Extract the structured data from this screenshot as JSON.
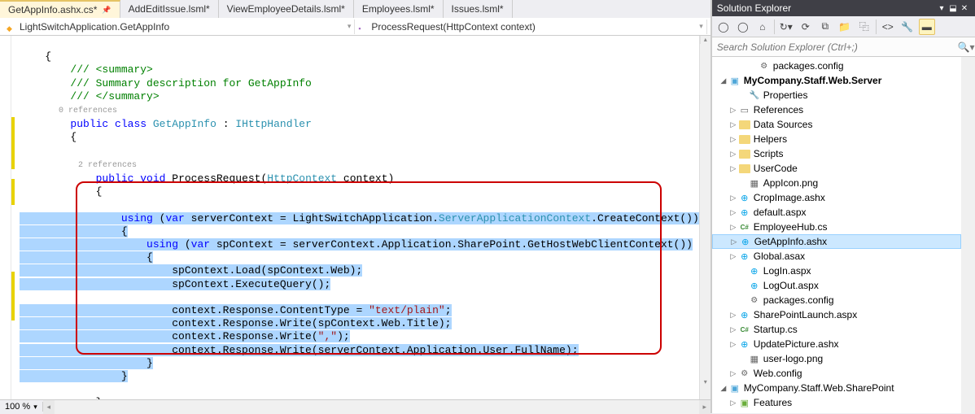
{
  "tabs": [
    {
      "label": "GetAppInfo.ashx.cs*",
      "active": true,
      "pinned": true
    },
    {
      "label": "AddEditIssue.lsml*",
      "active": false
    },
    {
      "label": "ViewEmployeeDetails.lsml*",
      "active": false
    },
    {
      "label": "Employees.lsml*",
      "active": false
    },
    {
      "label": "Issues.lsml*",
      "active": false
    }
  ],
  "crumb_left": "LightSwitchApplication.GetAppInfo",
  "crumb_right": "ProcessRequest(HttpContext context)",
  "zoom": "100 %",
  "code": {
    "l1": "    {",
    "l2": "        /// <summary>",
    "l3": "        /// Summary description for GetAppInfo",
    "l4": "        /// </summary>",
    "l5_ref": "        0 references",
    "l5_a": "        ",
    "l5_b": "public",
    " l5_c": " ",
    "l5_d": "class",
    "l5_e": " ",
    "l5_f": "GetAppInfo",
    "l5_g": " : ",
    "l5_h": "IHttpHandler",
    "l6": "        {",
    "l7": "",
    "l8_ref": "            2 references",
    "l8_a": "            ",
    "l8_b": "public",
    "l8_c": " ",
    "l8_d": "void",
    "l8_e": " ProcessRequest(",
    "l8_f": "HttpContext",
    "l8_g": " context)",
    "l9": "            {",
    "l10": "",
    "l11_a": "                ",
    "l11_b": "using",
    "l11_c": " (",
    "l11_d": "var",
    "l11_e": " serverContext = LightSwitchApplication.",
    "l11_f": "ServerApplicationContext",
    "l11_g": ".CreateContext())",
    "l12": "                {",
    "l13_a": "                    ",
    "l13_b": "using",
    "l13_c": " (",
    "l13_d": "var",
    "l13_e": " spContext = serverContext.Application.SharePoint.GetHostWebClientContext())",
    "l14": "                    {",
    "l15": "                        spContext.Load(spContext.Web);",
    "l16": "                        spContext.ExecuteQuery();",
    "l17": "",
    "l18_a": "                        context.Response.ContentType = ",
    "l18_b": "\"text/plain\"",
    "l18_c": ";",
    "l19": "                        context.Response.Write(spContext.Web.Title);",
    "l20_a": "                        context.Response.Write(",
    "l20_b": "\",\"",
    "l20_c": ");",
    "l21": "                        context.Response.Write(serverContext.Application.User.FullName);",
    "l22": "                    }",
    "l23": "                }",
    "l24": "",
    "l25": "            }"
  },
  "panel_title": "Solution Explorer",
  "search_placeholder": "Search Solution Explorer (Ctrl+;)",
  "tree": {
    "n0": "packages.config",
    "n1": "MyCompany.Staff.Web.Server",
    "n2": "Properties",
    "n3": "References",
    "n4": "Data Sources",
    "n5": "Helpers",
    "n6": "Scripts",
    "n7": "UserCode",
    "n8": "AppIcon.png",
    "n9": "CropImage.ashx",
    "n10": "default.aspx",
    "n11": "EmployeeHub.cs",
    "n12": "GetAppInfo.ashx",
    "n13": "Global.asax",
    "n14": "LogIn.aspx",
    "n15": "LogOut.aspx",
    "n16": "packages.config",
    "n17": "SharePointLaunch.aspx",
    "n18": "Startup.cs",
    "n19": "UpdatePicture.ashx",
    "n20": "user-logo.png",
    "n21": "Web.config",
    "n22": "MyCompany.Staff.Web.SharePoint",
    "n23": "Features"
  }
}
